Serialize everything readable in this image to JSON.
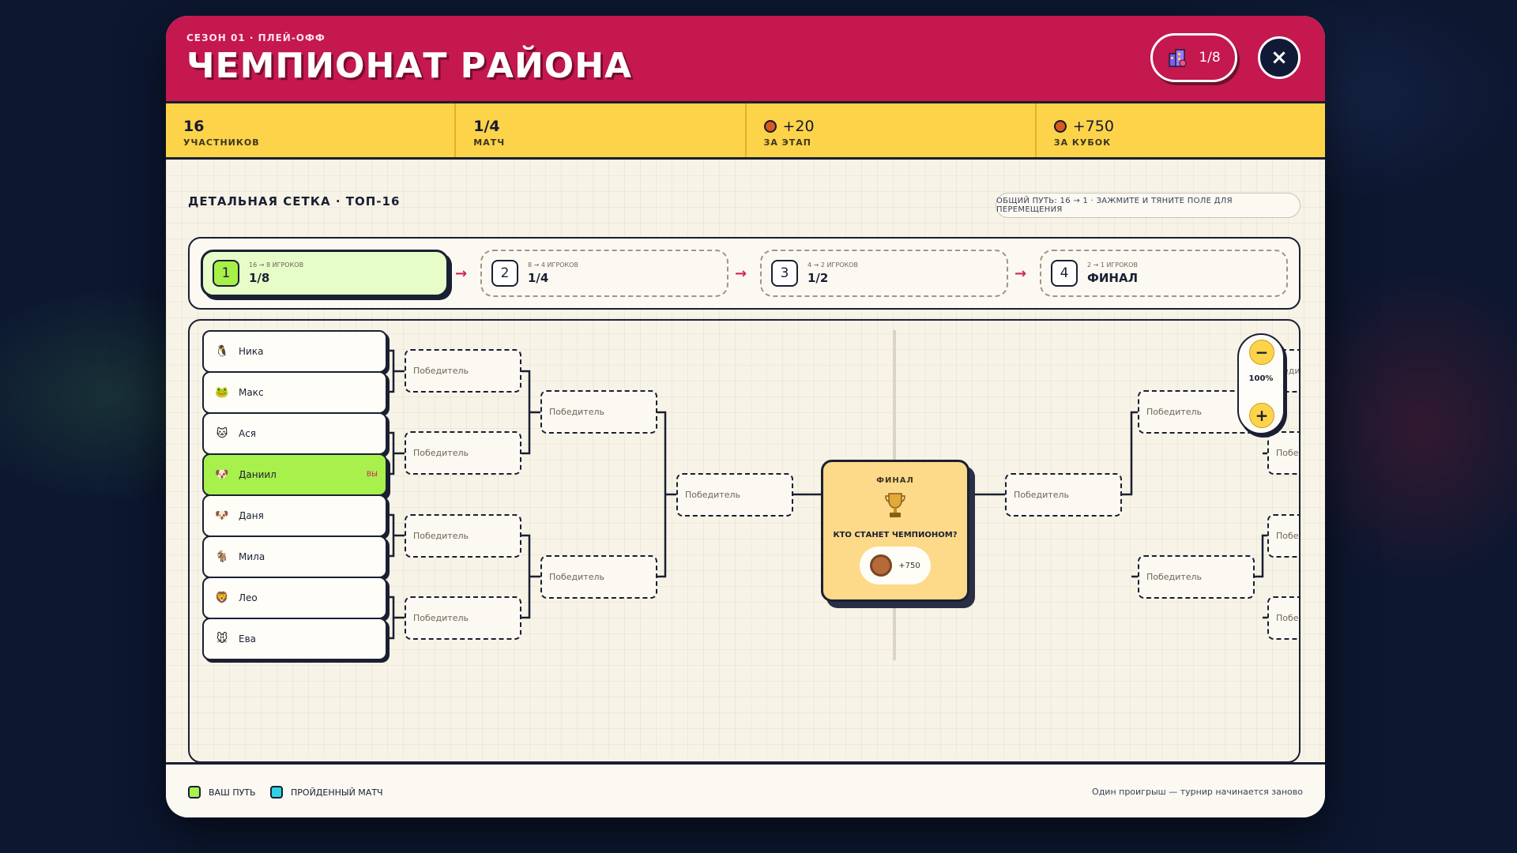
{
  "header": {
    "kicker": "СЕЗОН 01 · ПЛЕЙ-ОФФ",
    "title": "ЧЕМПИОНАТ РАЙОНА",
    "stage_badge": "1/8",
    "close_label": "×"
  },
  "stats": [
    {
      "value": "16",
      "label": "УЧАСТНИКОВ",
      "icon": ""
    },
    {
      "value": "1/4",
      "label": "МАТЧ",
      "icon": ""
    },
    {
      "value": "+20",
      "label": "ЗА ЭТАП",
      "icon": "paw-coin-icon"
    },
    {
      "value": "+750",
      "label": "ЗА КУБОК",
      "icon": "paw-coin-icon"
    }
  ],
  "section": {
    "title": "ДЕТАЛЬНАЯ СЕТКА · ТОП-16",
    "hint": "ОБЩИЙ ПУТЬ: 16 → 1 · ЗАЖМИТЕ И ТЯНИТЕ ПОЛЕ ДЛЯ ПЕРЕМЕЩЕНИЯ"
  },
  "stages": [
    {
      "num": "1",
      "sub": "16 → 8 ИГРОКОВ",
      "name": "1/8",
      "active": true
    },
    {
      "num": "2",
      "sub": "8 → 4 ИГРОКОВ",
      "name": "1/4",
      "active": false
    },
    {
      "num": "3",
      "sub": "4 → 2 ИГРОКОВ",
      "name": "1/2",
      "active": false
    },
    {
      "num": "4",
      "sub": "2 → 1 ИГРОКОВ",
      "name": "ФИНАЛ",
      "active": false
    }
  ],
  "stage_arrow": "→",
  "players": [
    {
      "name": "Ника",
      "avatar": "🐧",
      "you": false
    },
    {
      "name": "Макс",
      "avatar": "🐸",
      "you": false
    },
    {
      "name": "Ася",
      "avatar": "🐱",
      "you": false
    },
    {
      "name": "Даниил",
      "avatar": "🐶",
      "you": true
    },
    {
      "name": "Даня",
      "avatar": "🐶",
      "you": false
    },
    {
      "name": "Мила",
      "avatar": "🐐",
      "you": false
    },
    {
      "name": "Лео",
      "avatar": "🦁",
      "you": false
    },
    {
      "name": "Ева",
      "avatar": "🐭",
      "you": false
    }
  ],
  "you_tag": "ВЫ",
  "winner_placeholder": "Победитель",
  "right_partial_text": "Побед",
  "right_partial_text_top": "еди",
  "final": {
    "label": "ФИНАЛ",
    "question": "КТО СТАНЕТ ЧЕМПИОНОМ?",
    "prize": "+750"
  },
  "zoom": {
    "minus": "−",
    "level": "100%",
    "plus": "+"
  },
  "legend": [
    {
      "label": "ВАШ ПУТЬ",
      "color": "#a8f04c"
    },
    {
      "label": "ПРОЙДЕННЫЙ МАТЧ",
      "color": "#2fd3e6"
    }
  ],
  "footer_note": "Один проигрыш — турнир начинается заново",
  "colors": {
    "header": "#c4184f",
    "stats": "#fdd34a",
    "accent": "#a8f04c",
    "ink": "#1a1f33"
  }
}
